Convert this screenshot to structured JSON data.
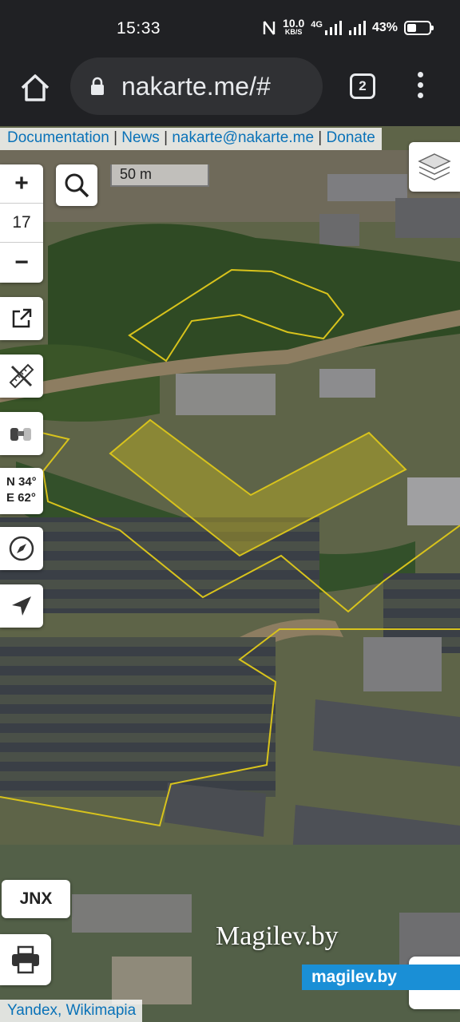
{
  "status_bar": {
    "time": "15:33",
    "network_speed_value": "10.0",
    "network_speed_unit": "KB/S",
    "network_type": "4G",
    "battery_percent_label": "43%",
    "battery_level": 0.43,
    "icons": [
      "nfc-icon",
      "signal-icon",
      "signal-icon",
      "battery-icon"
    ]
  },
  "browser": {
    "url": "nakarte.me/#",
    "tab_count": "2",
    "icons": [
      "home-icon",
      "lock-icon",
      "tabs-icon",
      "overflow-menu-icon"
    ]
  },
  "map": {
    "top_attribution": {
      "links": [
        "Documentation",
        "News",
        "nakarte@nakarte.me",
        "Donate"
      ],
      "separator": " | "
    },
    "zoom": {
      "plus": "+",
      "level": "17",
      "minus": "−"
    },
    "scale_label": "50 m",
    "coordinates": {
      "lat": "N 34°",
      "lon": "E 62°"
    },
    "jnx_button": "JNX",
    "bottom_attribution": "Yandex, Wikimapia",
    "watermark_text": "Magilev.by",
    "brand_badge": "magilev.by",
    "control_icons": [
      "search-icon",
      "layers-icon",
      "share-link-icon",
      "ruler-pencil-icon",
      "binoculars-icon",
      "compass-icon",
      "locate-arrow-icon",
      "print-icon",
      "route-icon"
    ],
    "colors": {
      "polygon_stroke": "#d8c31c",
      "polygon_fill": "#c9b71f",
      "brand": "#1a8fd6"
    }
  }
}
